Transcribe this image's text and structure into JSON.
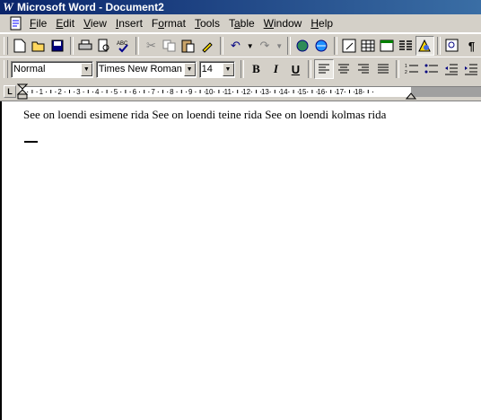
{
  "window": {
    "title": "Microsoft Word - Document2",
    "app_icon": "W"
  },
  "menu": [
    {
      "label": "File",
      "u": "F",
      "rest": "ile"
    },
    {
      "label": "Edit",
      "u": "E",
      "rest": "dit"
    },
    {
      "label": "View",
      "u": "V",
      "rest": "iew"
    },
    {
      "label": "Insert",
      "u": "I",
      "rest": "nsert"
    },
    {
      "label": "Format",
      "pre": "F",
      "u": "o",
      "rest": "rmat"
    },
    {
      "label": "Tools",
      "u": "T",
      "rest": "ools"
    },
    {
      "label": "Table",
      "pre": "T",
      "u": "a",
      "rest": "ble"
    },
    {
      "label": "Window",
      "u": "W",
      "rest": "indow"
    },
    {
      "label": "Help",
      "u": "H",
      "rest": "elp"
    }
  ],
  "formatting": {
    "style": "Normal",
    "font": "Times New Roman",
    "size": "14",
    "bold": "B",
    "italic": "I",
    "underline": "U"
  },
  "ruler": {
    "tab_selector": "L",
    "numbers": [
      "1",
      "2",
      "3",
      "4",
      "5",
      "6",
      "7",
      "8",
      "9",
      "10",
      "11",
      "12",
      "13",
      "14",
      "15",
      "16",
      "17",
      "18"
    ]
  },
  "document": {
    "text": "See on loendi esimene rida See on loendi teine rida See on loendi kolmas rida"
  }
}
